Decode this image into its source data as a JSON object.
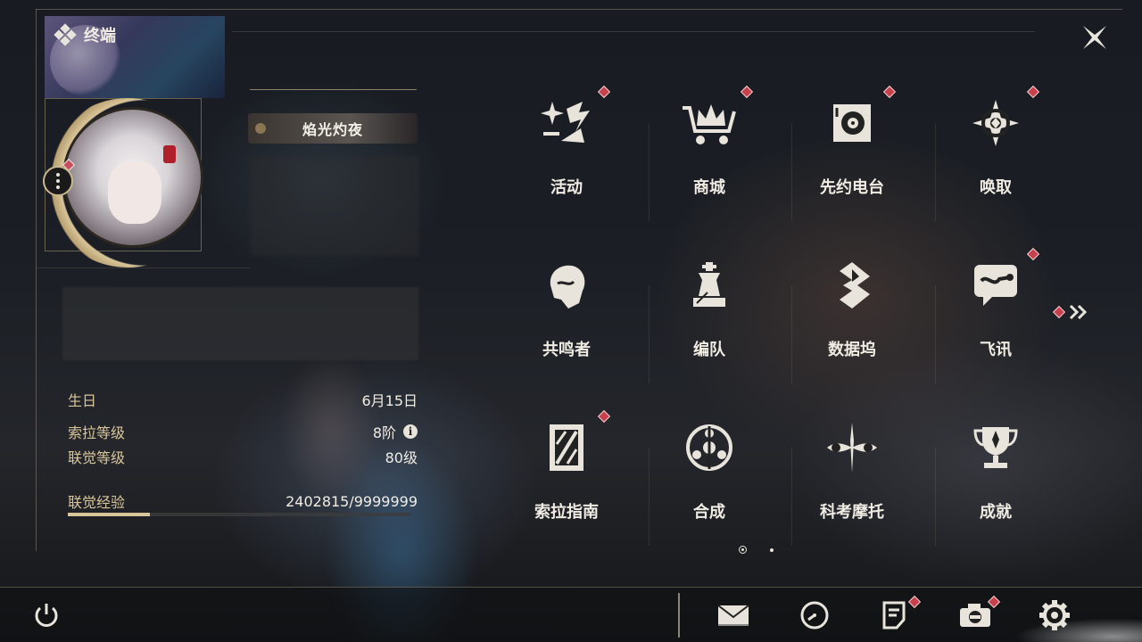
{
  "window": {
    "title": "终端"
  },
  "profile": {
    "name": "焰光灼夜",
    "stats": [
      {
        "label": "生日",
        "value": "6月15日"
      },
      {
        "label": "索拉等级",
        "value": "8阶"
      },
      {
        "label": "联觉等级",
        "value": "80级"
      }
    ],
    "exp": {
      "label": "联觉经验",
      "value": "2402815/9999999",
      "fraction": 0.24
    }
  },
  "menu": {
    "items": [
      {
        "label": "活动",
        "icon": "sparkle-icon",
        "notify": true
      },
      {
        "label": "商城",
        "icon": "crown-cart-icon",
        "notify": true
      },
      {
        "label": "先约电台",
        "icon": "radio-icon",
        "notify": true
      },
      {
        "label": "唤取",
        "icon": "compass-star-icon",
        "notify": true
      },
      {
        "label": "共鸣者",
        "icon": "character-head-icon",
        "notify": false
      },
      {
        "label": "编队",
        "icon": "chess-piece-icon",
        "notify": false
      },
      {
        "label": "数据坞",
        "icon": "data-dock-icon",
        "notify": false
      },
      {
        "label": "飞讯",
        "icon": "chat-bubble-icon",
        "notify": true
      },
      {
        "label": "索拉指南",
        "icon": "guide-book-icon",
        "notify": true
      },
      {
        "label": "合成",
        "icon": "synthesis-icon",
        "notify": false
      },
      {
        "label": "科考摩托",
        "icon": "motorbike-icon",
        "notify": false
      },
      {
        "label": "成就",
        "icon": "trophy-icon",
        "notify": false
      }
    ],
    "page": {
      "current": 1,
      "total": 2
    }
  },
  "bottom": {
    "icons": [
      "power-icon",
      "mail-icon",
      "clock-icon",
      "notes-icon",
      "camera-icon",
      "settings-icon"
    ]
  },
  "colors": {
    "accent": "#d9c59a",
    "notify": "#c8404c",
    "text": "#f0ece4"
  }
}
